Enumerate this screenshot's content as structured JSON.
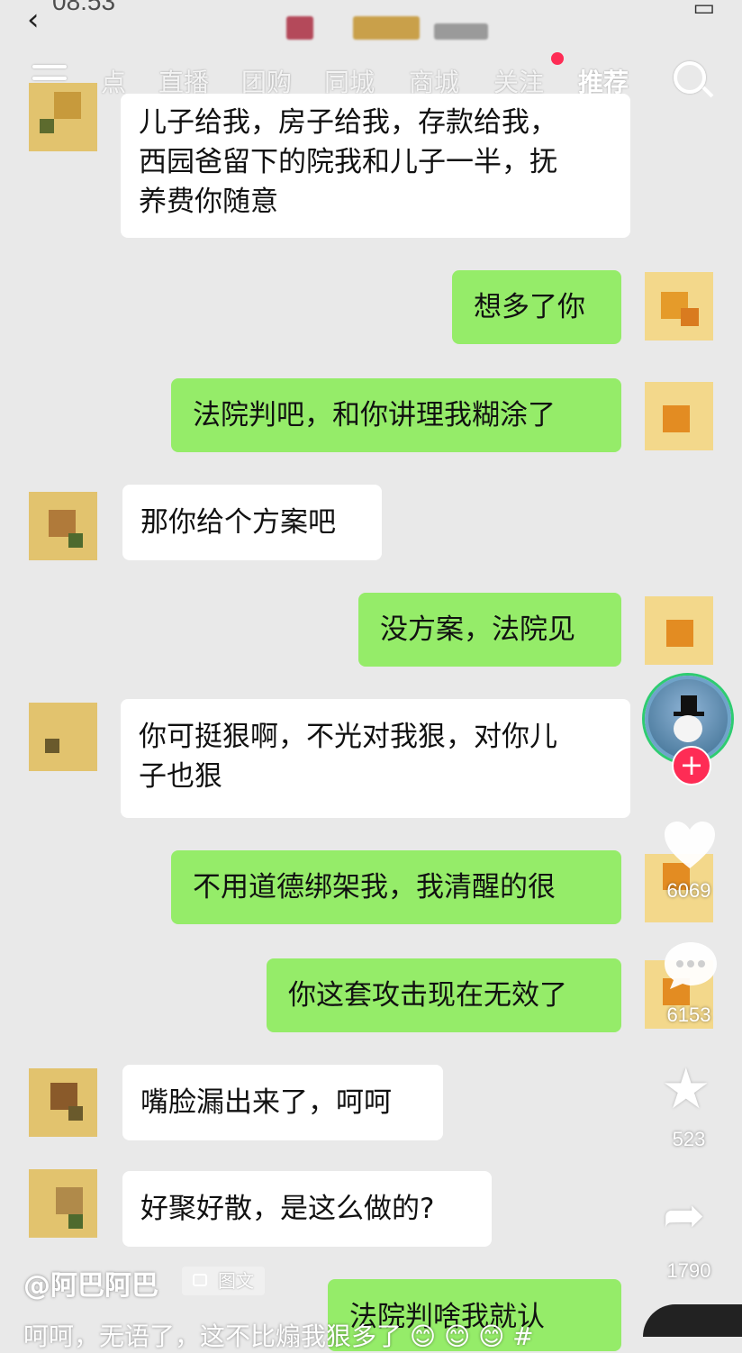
{
  "status_bar": {
    "time": "08:53"
  },
  "nav": {
    "tabs": [
      "点",
      "直播",
      "团购",
      "同城",
      "商城",
      "关注",
      "推荐"
    ],
    "active_tab": "推荐"
  },
  "messages": [
    {
      "side": "left",
      "lines": [
        "儿子给我，房子给我，存款给我，",
        "西园爸留下的院我和儿子一半，抚",
        "养费你随意"
      ]
    },
    {
      "side": "right",
      "lines": [
        "想多了你"
      ]
    },
    {
      "side": "right",
      "lines": [
        "法院判吧，和你讲理我糊涂了"
      ]
    },
    {
      "side": "left",
      "lines": [
        "那你给个方案吧"
      ]
    },
    {
      "side": "right",
      "lines": [
        "没方案，法院见"
      ]
    },
    {
      "side": "left",
      "lines": [
        "你可挺狠啊，不光对我狠，对你儿",
        "子也狠"
      ]
    },
    {
      "side": "right",
      "lines": [
        "不用道德绑架我，我清醒的很"
      ]
    },
    {
      "side": "right",
      "lines": [
        "你这套攻击现在无效了"
      ]
    },
    {
      "side": "left",
      "lines": [
        "嘴脸漏出来了，呵呵"
      ]
    },
    {
      "side": "left",
      "lines": [
        "好聚好散，是这么做的?"
      ]
    },
    {
      "side": "right",
      "lines": [
        "法院判啥我就认"
      ]
    }
  ],
  "sidebar": {
    "likes": "6069",
    "comments": "6153",
    "favorites": "523",
    "shares": "1790"
  },
  "post": {
    "author": "@阿巴阿巴",
    "tag": "图文",
    "caption": "呵呵，无语了，这不比煽我狠多了 😊 😊 😊 #"
  },
  "colors": {
    "accent": "#fe2c55",
    "bubble_right": "#95ec69",
    "bubble_left": "#ffffff",
    "background": "#e9e9e9"
  }
}
